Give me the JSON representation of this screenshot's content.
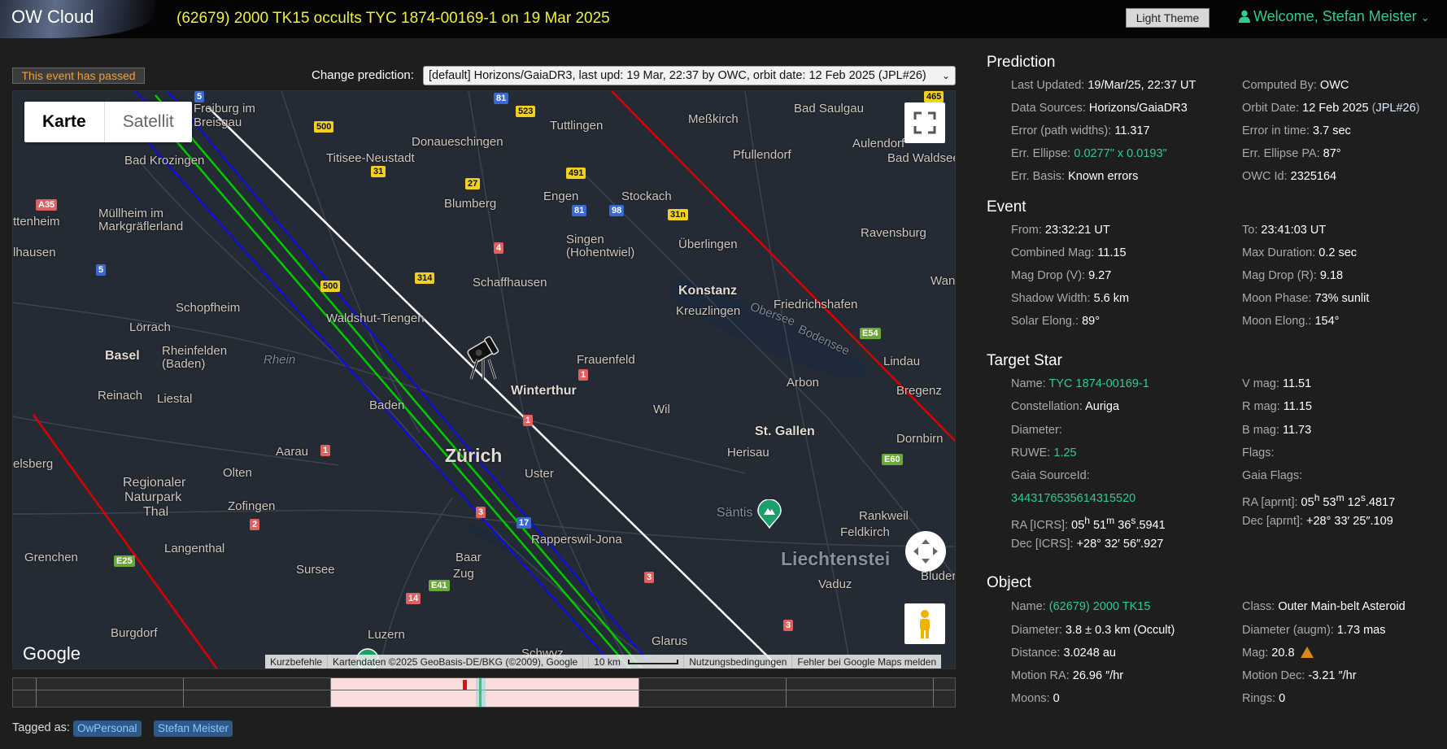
{
  "header": {
    "logo": "OW Cloud",
    "event_title": "(62679) 2000 TK15 occults TYC 1874-00169-1 on 19 Mar 2025",
    "theme_button": "Light Theme",
    "welcome": "Welcome, Stefan Meister"
  },
  "controls": {
    "passed_badge": "This event has passed",
    "change_prediction_label": "Change prediction:",
    "prediction_selected": "[default] Horizons/GaiaDR3, last upd: 19 Mar, 22:37 by OWC, orbit date: 12 Feb 2025 (JPL#26)"
  },
  "map": {
    "type_map": "Karte",
    "type_satellite": "Satellit",
    "google": "Google",
    "attribution": {
      "shortcuts": "Kurzbefehle",
      "data": "Kartendaten ©2025 GeoBasis-DE/BKG (©2009), Google",
      "scale": "10 km",
      "terms": "Nutzungsbedingungen",
      "report": "Fehler bei Google Maps melden"
    },
    "labels": {
      "freiburg": "Freiburg im Breisgau",
      "bad_krozingen": "Bad Krozingen",
      "mullheim": "Müllheim im Markgräflerland",
      "ettenheim": "ttenheim",
      "lhausen": "lhausen",
      "titisee": "Titisee-Neustadt",
      "donaueschingen": "Donaueschingen",
      "tuttlingen": "Tuttlingen",
      "messkirch": "Meßkirch",
      "bad_saulgau": "Bad Saulgau",
      "aulendorf": "Aulendorf",
      "pfullendorf": "Pfullendorf",
      "bad_waldsee": "Bad Waldsee",
      "blumberg": "Blumberg",
      "engen": "Engen",
      "stockach": "Stockach",
      "singen": "Singen (Hohentwiel)",
      "uberlingen": "Überlingen",
      "ravensburg": "Ravensburg",
      "schaffhausen": "Schaffhausen",
      "konstanz": "Konstanz",
      "kreuzlingen": "Kreuzlingen",
      "friedrichshafen": "Friedrichshafen",
      "wangen": "Wang",
      "schopfheim": "Schopfheim",
      "lorrach": "Lörrach",
      "waldshut": "Waldshut-Tiengen",
      "basel": "Basel",
      "rheinfelden": "Rheinfelden (Baden)",
      "rhein": "Rhein",
      "frauenfeld": "Frauenfeld",
      "obersee": "Obersee",
      "bodensee": "Bodensee",
      "lindau": "Lindau",
      "reinach": "Reinach",
      "liestal": "Liestal",
      "baden": "Baden",
      "winterthur": "Winterthur",
      "wil": "Wil",
      "arbon": "Arbon",
      "bregenz": "Bregenz",
      "aarau": "Aarau",
      "zurich": "Zürich",
      "uster": "Uster",
      "st_gallen": "St. Gallen",
      "herisau": "Herisau",
      "dornbirn": "Dornbirn",
      "delsberg": "elsberg",
      "regionaler": "Regionaler",
      "naturpark": "Naturpark",
      "thal": "Thal",
      "olten": "Olten",
      "zofingen": "Zofingen",
      "rapperswil": "Rapperswil-Jona",
      "santis": "Säntis",
      "rankweil": "Rankweil",
      "feldkirch": "Feldkirch",
      "grenchen": "Grenchen",
      "langenthal": "Langenthal",
      "sursee": "Sursee",
      "baar": "Baar",
      "zug": "Zug",
      "liechtenstein": "Liechtenstei",
      "vaduz": "Vaduz",
      "bluder": "Bluder",
      "burgdorf": "Burgdorf",
      "luzern": "Luzern",
      "schwyz": "Schwyz",
      "glarus": "Glarus"
    },
    "roads": [
      "500",
      "523",
      "81",
      "31",
      "27",
      "491",
      "81",
      "98",
      "31n",
      "4",
      "314",
      "500",
      "5",
      "A35",
      "E54",
      "1",
      "1",
      "1",
      "E60",
      "3",
      "17",
      "2",
      "E25",
      "E41",
      "14",
      "3",
      "3",
      "465",
      "5"
    ]
  },
  "tags": {
    "label": "Tagged as:",
    "items": [
      "OwPersonal",
      "Stefan Meister"
    ]
  },
  "prediction": {
    "title": "Prediction",
    "last_updated_k": "Last Updated:",
    "last_updated_v": "19/Mar/25, 22:37 UT",
    "computed_by_k": "Computed By:",
    "computed_by_v": "OWC",
    "data_sources_k": "Data Sources:",
    "data_sources_v": "Horizons/GaiaDR3",
    "orbit_date_k": "Orbit Date:",
    "orbit_date_v": "12 Feb 2025",
    "orbit_jpl": "JPL#26",
    "error_path_k": "Error (path widths):",
    "error_path_v": "11.317",
    "error_time_k": "Error in time:",
    "error_time_v": "3.7 sec",
    "err_ellipse_k": "Err. Ellipse:",
    "err_ellipse_v": "0.0277\" x 0.0193\"",
    "err_ellipse_pa_k": "Err. Ellipse PA:",
    "err_ellipse_pa_v": "87°",
    "err_basis_k": "Err. Basis:",
    "err_basis_v": "Known errors",
    "owc_id_k": "OWC Id:",
    "owc_id_v": "2325164"
  },
  "event": {
    "title": "Event",
    "from_k": "From:",
    "from_v": "23:32:21 UT",
    "to_k": "To:",
    "to_v": "23:41:03 UT",
    "combined_mag_k": "Combined Mag:",
    "combined_mag_v": "11.15",
    "max_duration_k": "Max Duration:",
    "max_duration_v": "0.2 sec",
    "mag_drop_v_k": "Mag Drop (V):",
    "mag_drop_v_v": "9.27",
    "mag_drop_r_k": "Mag Drop (R):",
    "mag_drop_r_v": "9.18",
    "shadow_width_k": "Shadow Width:",
    "shadow_width_v": "5.6 km",
    "moon_phase_k": "Moon Phase:",
    "moon_phase_v": "73% sunlit",
    "solar_elong_k": "Solar Elong.:",
    "solar_elong_v": "89°",
    "moon_elong_k": "Moon Elong.:",
    "moon_elong_v": "154°"
  },
  "target_star": {
    "title": "Target Star",
    "name_k": "Name:",
    "name_v": "TYC 1874-00169-1",
    "vmag_k": "V mag:",
    "vmag_v": "11.51",
    "constellation_k": "Constellation:",
    "constellation_v": "Auriga",
    "rmag_k": "R mag:",
    "rmag_v": "11.15",
    "diameter_k": "Diameter:",
    "bmag_k": "B mag:",
    "bmag_v": "11.73",
    "ruwe_k": "RUWE:",
    "ruwe_v": "1.25",
    "flags_k": "Flags:",
    "gaia_source_k": "Gaia SourceId:",
    "gaia_source_v": "3443176535614315520",
    "gaia_flags_k": "Gaia Flags:",
    "ra_aprnt_k": "RA [aprnt]:",
    "ra_icrs_k": "RA [ICRS]:",
    "dec_aprnt_k": "Dec [aprnt]:",
    "dec_aprnt_v": "+28° 33′ 25″.109",
    "dec_icrs_k": "Dec [ICRS]:",
    "dec_icrs_v": "+28° 32′ 56″.927"
  },
  "object": {
    "title": "Object",
    "name_k": "Name:",
    "name_v": "(62679) 2000 TK15",
    "class_k": "Class:",
    "class_v": "Outer Main-belt Asteroid",
    "diameter_k": "Diameter:",
    "diameter_v": "3.8 ± 0.3 km",
    "diameter_src": "(Occult)",
    "diameter_augm_k": "Diameter (augm):",
    "diameter_augm_v": "1.73 mas",
    "distance_k": "Distance:",
    "distance_v": "3.0248 au",
    "mag_k": "Mag:",
    "mag_v": "20.8",
    "motion_ra_k": "Motion RA:",
    "motion_ra_v": "26.96 ″/hr",
    "motion_dec_k": "Motion Dec:",
    "motion_dec_v": "-3.21 ″/hr",
    "moons_k": "Moons:",
    "moons_v": "0",
    "rings_k": "Rings:",
    "rings_v": "0"
  },
  "colors": {
    "accent_green": "#2ecc8f",
    "title_yellow": "#f0ef3c",
    "passed_orange": "#f0a030",
    "path_center": "#ffffff",
    "path_shadow": "#00cc00",
    "path_error": "#1010d0",
    "path_limit": "#dd0000"
  }
}
